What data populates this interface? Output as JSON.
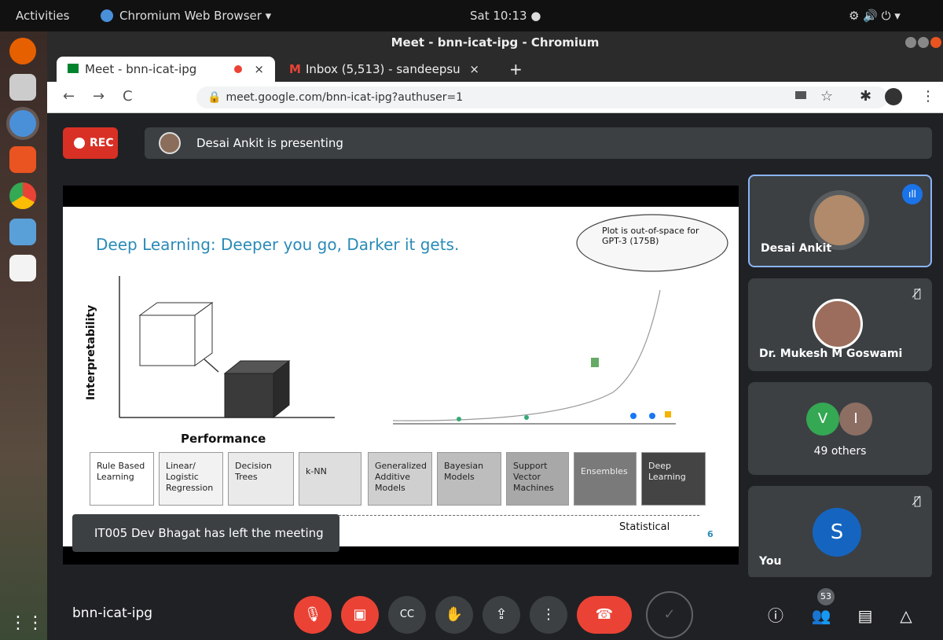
{
  "topbar": {
    "activities": "Activities",
    "app": "Chromium Web Browser ▾",
    "clock": "Sat 10:13 ●",
    "status_icons": "⚙ 🔊 ⏻ ▾"
  },
  "window": {
    "title": "Meet - bnn-icat-ipg - Chromium"
  },
  "tabs": [
    {
      "label": "Meet - bnn-icat-ipg"
    },
    {
      "label": "Inbox (5,513) - sandeepsu"
    }
  ],
  "address": {
    "url": "meet.google.com/bnn-icat-ipg?authuser=1"
  },
  "meet": {
    "rec_label": "REC",
    "presenting_text": "Desai Ankit is presenting",
    "toast": "IT005 Dev Bhagat has left the meeting",
    "meeting_code": "bnn-icat-ipg",
    "participants_badge": "53"
  },
  "participants": [
    {
      "name": "Desai Ankit"
    },
    {
      "name": "Dr. Mukesh M Goswami"
    },
    {
      "name": "49 others",
      "initials": [
        "V",
        "I"
      ]
    },
    {
      "name": "You",
      "initial": "S"
    }
  ],
  "slide": {
    "title": "Deep Learning: Deeper you go, Darker it gets.",
    "cloud": "Plot is out-of-space for GPT-3 (175B)",
    "y_axis": "Interpretability",
    "x_axis": "Performance",
    "statistical": "Statistical",
    "page": "6",
    "models": [
      "Rule Based Learning",
      "Linear/ Logistic Regression",
      "Decision Trees",
      "k-NN",
      "Generalized Additive Models",
      "Bayesian Models",
      "Support Vector Machines",
      "Ensembles",
      "Deep Learning"
    ]
  },
  "colors": {
    "rec_red": "#d93025",
    "meet_bg": "#202124",
    "tile_bg": "#3c4043",
    "accent_blue": "#1a73e8"
  }
}
